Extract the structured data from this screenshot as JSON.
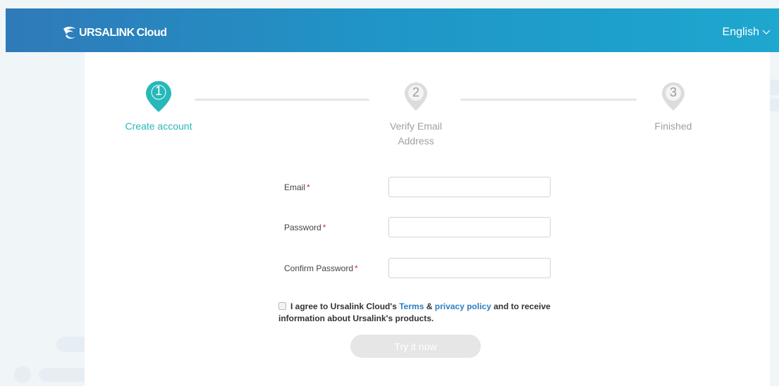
{
  "header": {
    "logo_text": "URSALINK",
    "logo_cloud": "Cloud",
    "language": "English"
  },
  "steps": [
    {
      "number": "1",
      "label": "Create account",
      "state": "active"
    },
    {
      "number": "2",
      "label": "Verify Email Address",
      "state": "inactive"
    },
    {
      "number": "3",
      "label": "Finished",
      "state": "inactive"
    }
  ],
  "form": {
    "email_label": "Email",
    "password_label": "Password",
    "confirm_label": "Confirm Password",
    "required_mark": "*",
    "email_value": "",
    "password_value": "",
    "confirm_value": ""
  },
  "agreement": {
    "prefix": "I agree to Ursalink Cloud's",
    "terms": "Terms",
    "amp": "&",
    "privacy": "privacy policy",
    "suffix": "and to receive information about Ursalink's products."
  },
  "submit_label": "Try it now",
  "colors": {
    "header_start": "#2f7ab9",
    "header_end": "#1ea7cf",
    "active_step": "#27b8ba",
    "inactive_step": "#dcdcdc",
    "required": "#e0272b",
    "link": "#2d7fc1"
  }
}
